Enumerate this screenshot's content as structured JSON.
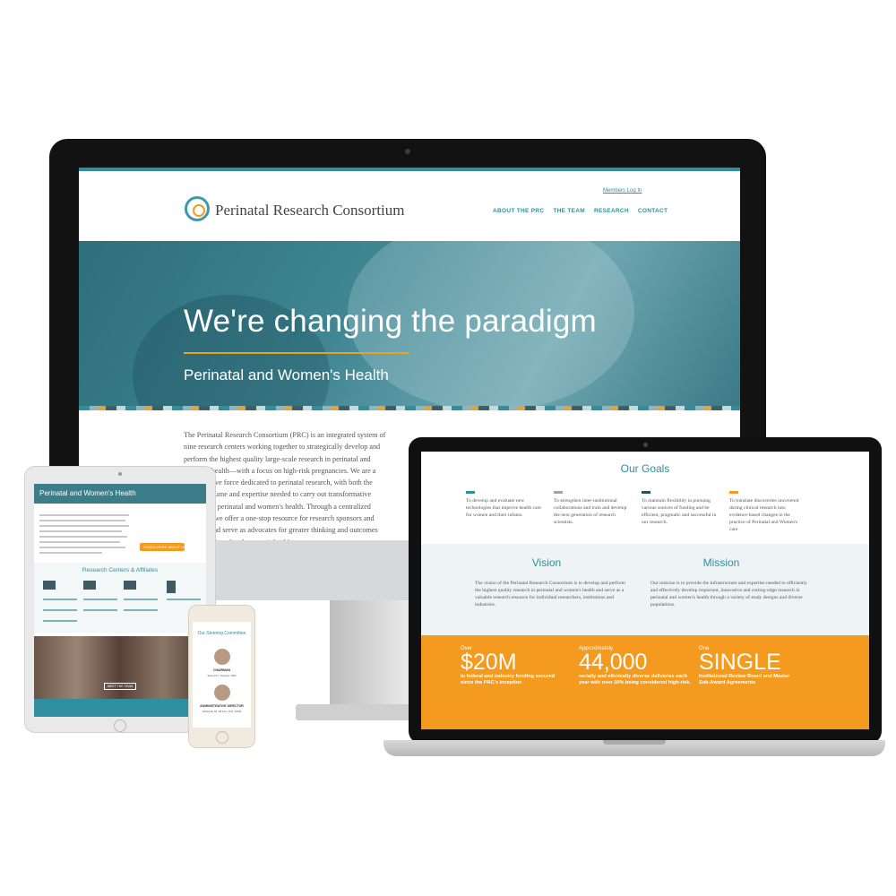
{
  "imac": {
    "site_title": "Perinatal Research Consortium",
    "members_link": "Members Log In",
    "nav": [
      "ABOUT THE PRC",
      "THE TEAM",
      "RESEARCH",
      "CONTACT"
    ],
    "hero_title": "We're changing the paradigm",
    "hero_subtitle": "Perinatal and Women's Health",
    "body_text": "The Perinatal Research Consortium (PRC) is an integrated system of nine research centers working together to strategically develop and perform the highest quality large-scale research in perinatal and women's health—with a focus on high-risk pregnancies. We are a collaborative force dedicated to perinatal research, with both the patient volume and expertise needed to carry out transformative research in perinatal and women's health. Through a centralized approach, we offer a one-stop resource for research sponsors and grantees and serve as advocates for greater thinking and outcomes around perinatal and women's health."
  },
  "laptop": {
    "goals_title": "Our Goals",
    "goals": [
      {
        "text": "To develop and evaluate new technologies that improve health care for women and their infants.",
        "color": "#2f8f9e"
      },
      {
        "text": "To strengthen inter-institutional collaborations and train and develop the next generation of research scientists.",
        "color": "#9aa6a8"
      },
      {
        "text": "To maintain flexibility in pursuing various sources of funding and be efficient, pragmatic and successful in our research.",
        "color": "#24545c"
      },
      {
        "text": "To translate discoveries uncovered during clinical research into evidence-based changes in the practice of Perinatal and Women's care.",
        "color": "#f39a1f"
      }
    ],
    "vision_title": "Vision",
    "vision_text": "The vision of the Perinatal Research Consortium is to develop and perform the highest quality research in perinatal and women's health and serve as a valuable research resource for individual researchers, institutions and industries.",
    "mission_title": "Mission",
    "mission_text": "Our mission is to provide the infrastructure and expertise needed to efficiently and effectively develop important, innovative and cutting-edge research in perinatal and women's health through a variety of study designs and diverse populations.",
    "stats": [
      {
        "label": "Over",
        "value": "$20M",
        "desc": "in federal and industry funding secured since the PRC's inception"
      },
      {
        "label": "Approximately",
        "value": "44,000",
        "desc": "racially and ethnically diverse deliveries each year with over 30% being considered high-risk."
      },
      {
        "label": "One",
        "value": "SINGLE",
        "desc": "Institutional Review Board and Master Sub-Award Agreements"
      }
    ]
  },
  "tablet": {
    "hero_title": "Perinatal and Women's Health",
    "learn_more": "LEARN MORE ABOUT US",
    "section_title": "Research Centers & Affiliates",
    "team_button": "MEET THE TEAM"
  },
  "phone": {
    "title": "Our Steering Committee",
    "role1": "CHAIRMAN",
    "name1": "Ronald J. Wapner, MD",
    "role2": "ADMINISTRATIVE DIRECTOR",
    "name2": "Michelle M. DiVito, RN, MSN"
  }
}
